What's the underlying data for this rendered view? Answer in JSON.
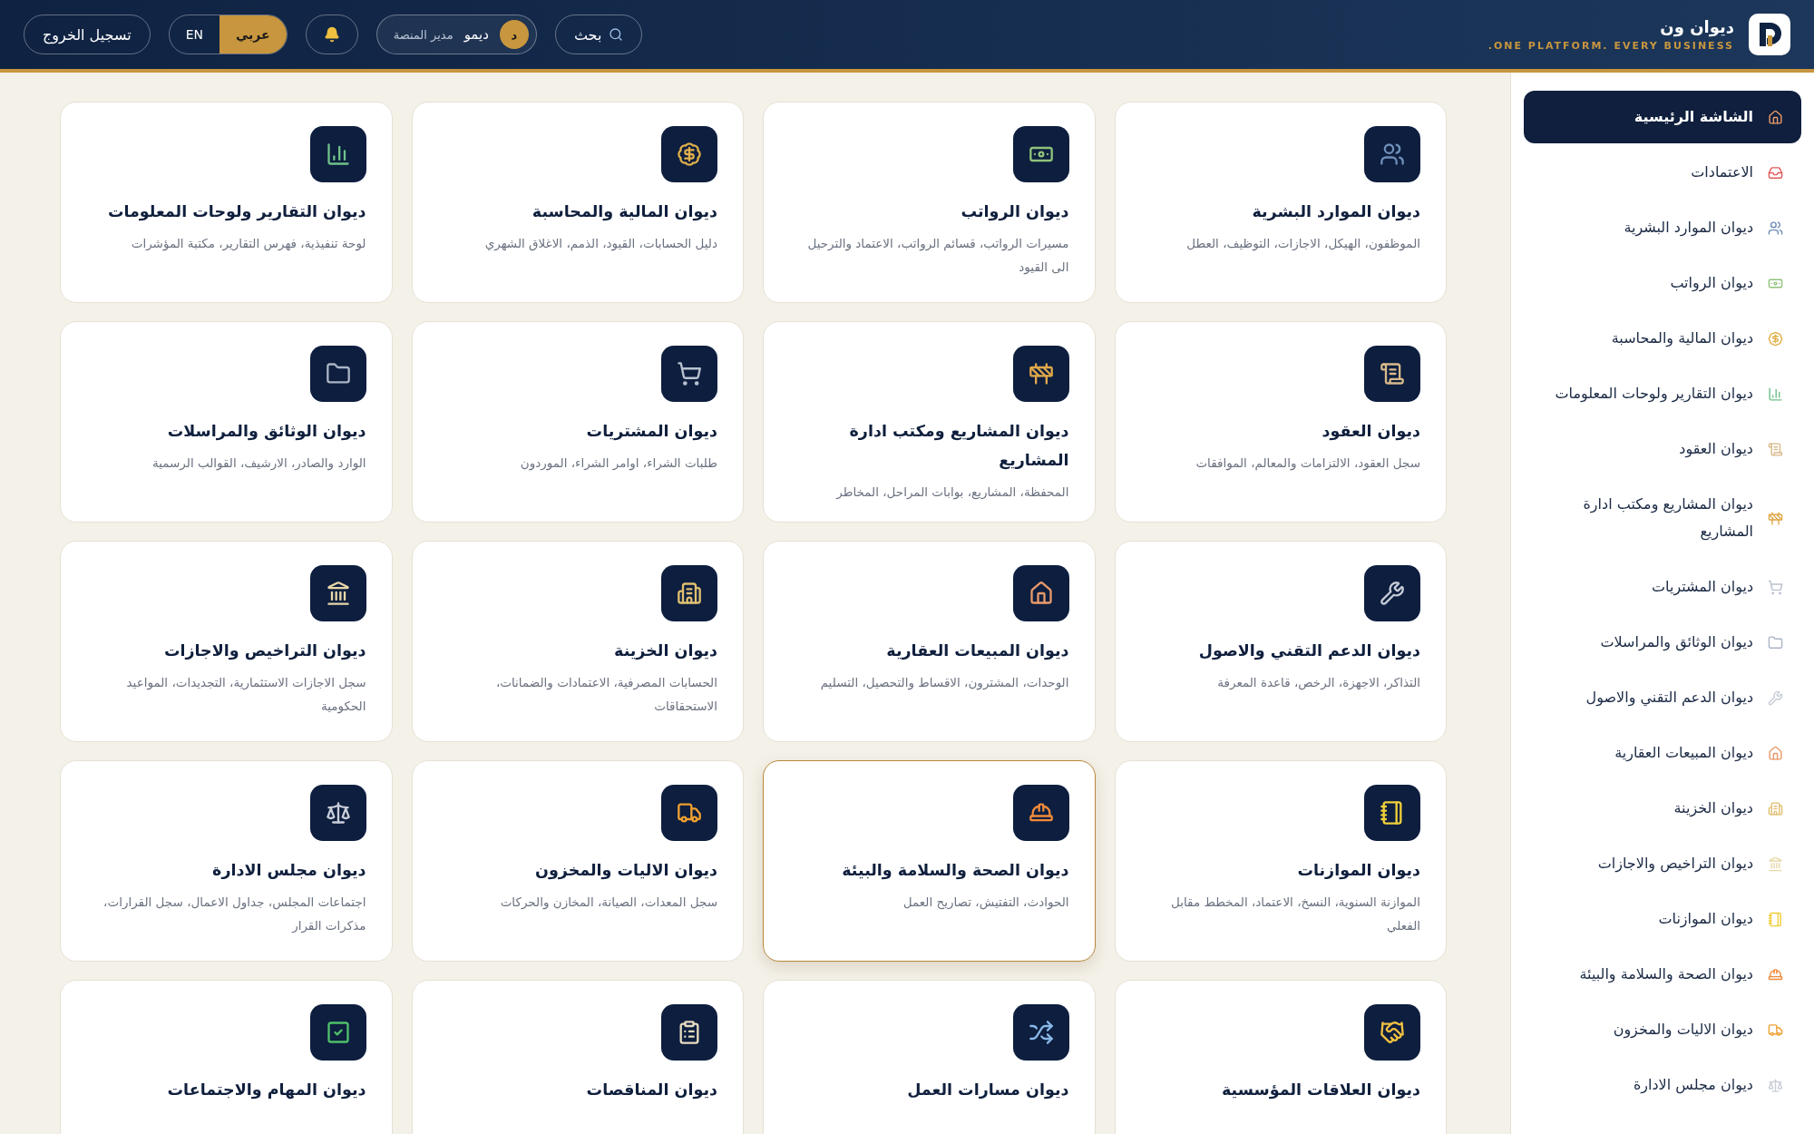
{
  "brand": {
    "name": "ديوان ون",
    "tagline": "ONE PLATFORM. EVERY BUSINESS."
  },
  "header": {
    "search": "بحث",
    "user": {
      "initial": "د",
      "name": "ديمو",
      "role": "مدير المنصة"
    },
    "languages": [
      {
        "label": "عربي",
        "selected": true
      },
      {
        "label": "EN",
        "selected": false
      }
    ],
    "logout": "تسجيل الخروج"
  },
  "sidebar": {
    "items": [
      {
        "label": "الشاشة الرئيسية",
        "selected": true
      },
      {
        "label": "الاعتمادات",
        "selected": false
      },
      {
        "label": "ديوان الموارد البشرية",
        "selected": false
      },
      {
        "label": "ديوان الرواتب",
        "selected": false
      },
      {
        "label": "ديوان المالية والمحاسبة",
        "selected": false
      },
      {
        "label": "ديوان التقارير ولوحات المعلومات",
        "selected": false
      },
      {
        "label": "ديوان العقود",
        "selected": false
      },
      {
        "label": "ديوان المشاريع ومكتب ادارة المشاريع",
        "selected": false
      },
      {
        "label": "ديوان المشتريات",
        "selected": false
      },
      {
        "label": "ديوان الوثائق والمراسلات",
        "selected": false
      },
      {
        "label": "ديوان الدعم التقني والاصول",
        "selected": false
      },
      {
        "label": "ديوان المبيعات العقارية",
        "selected": false
      },
      {
        "label": "ديوان الخزينة",
        "selected": false
      },
      {
        "label": "ديوان التراخيص والاجازات",
        "selected": false
      },
      {
        "label": "ديوان الموازنات",
        "selected": false
      },
      {
        "label": "ديوان الصحة والسلامة والبيئة",
        "selected": false
      },
      {
        "label": "ديوان الاليات والمخزون",
        "selected": false
      },
      {
        "label": "ديوان مجلس الادارة",
        "selected": false
      }
    ]
  },
  "cards": [
    {
      "title": "ديوان الموارد البشرية",
      "description": "الموظفون، الهيكل، الاجازات، التوظيف، العطل",
      "selected": false
    },
    {
      "title": "ديوان الرواتب",
      "description": "مسيرات الرواتب، قسائم الرواتب، الاعتماد والترحيل الى القيود",
      "selected": false
    },
    {
      "title": "ديوان المالية والمحاسبة",
      "description": "دليل الحسابات، القيود، الذمم، الاغلاق الشهري",
      "selected": false
    },
    {
      "title": "ديوان التقارير ولوحات المعلومات",
      "description": "لوحة تنفيذية، فهرس التقارير، مكتبة المؤشرات",
      "selected": false
    },
    {
      "title": "ديوان العقود",
      "description": "سجل العقود، الالتزامات والمعالم، الموافقات",
      "selected": false
    },
    {
      "title": "ديوان المشاريع ومكتب ادارة المشاريع",
      "description": "المحفظة، المشاريع، بوابات المراحل، المخاطر",
      "selected": false
    },
    {
      "title": "ديوان المشتريات",
      "description": "طلبات الشراء، اوامر الشراء، الموردون",
      "selected": false
    },
    {
      "title": "ديوان الوثائق والمراسلات",
      "description": "الوارد والصادر، الارشيف، القوالب الرسمية",
      "selected": false
    },
    {
      "title": "ديوان الدعم التقني والاصول",
      "description": "التذاكر، الاجهزة، الرخص، قاعدة المعرفة",
      "selected": false
    },
    {
      "title": "ديوان المبيعات العقارية",
      "description": "الوحدات، المشترون، الاقساط والتحصيل، التسليم",
      "selected": false
    },
    {
      "title": "ديوان الخزينة",
      "description": "الحسابات المصرفية، الاعتمادات والضمانات، الاستحقاقات",
      "selected": false
    },
    {
      "title": "ديوان التراخيص والاجازات",
      "description": "سجل الاجازات الاستثمارية، التجديدات، المواعيد الحكومية",
      "selected": false
    },
    {
      "title": "ديوان الموازنات",
      "description": "الموازنة السنوية، النسخ، الاعتماد، المخطط مقابل الفعلي",
      "selected": false
    },
    {
      "title": "ديوان الصحة والسلامة والبيئة",
      "description": "الحوادث، التفتيش، تصاريح العمل",
      "selected": true
    },
    {
      "title": "ديوان الاليات والمخزون",
      "description": "سجل المعدات، الصيانة، المخازن والحركات",
      "selected": false
    },
    {
      "title": "ديوان مجلس الادارة",
      "description": "اجتماعات المجلس، جداول الاعمال، سجل القرارات، مذكرات القرار",
      "selected": false
    },
    {
      "title": "ديوان العلاقات المؤسسية",
      "selected": false
    },
    {
      "title": "ديوان مسارات العمل",
      "selected": false
    },
    {
      "title": "ديوان المناقصات",
      "selected": false
    },
    {
      "title": "ديوان المهام والاجتماعات",
      "selected": false
    }
  ]
}
